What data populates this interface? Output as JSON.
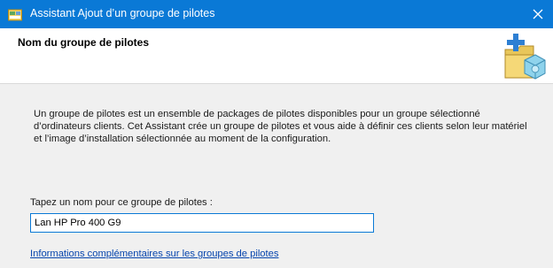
{
  "window": {
    "title": "Assistant Ajout d’un groupe de pilotes",
    "close_glyph": "✕"
  },
  "header": {
    "title": "Nom du groupe de pilotes",
    "icon": "driver-group-folder-icon"
  },
  "content": {
    "description": "Un groupe de pilotes est un ensemble de packages de pilotes disponibles pour un groupe sélectionné d’ordinateurs clients. Cet Assistant crée un groupe de pilotes et vous aide à définir ces clients selon leur matériel et l’image d’installation sélectionnée au moment de la configuration.",
    "name_label": "Tapez un nom pour ce groupe de pilotes :",
    "name_value": "Lan HP Pro 400 G9",
    "more_info_link": "Informations complémentaires sur les groupes de pilotes"
  },
  "colors": {
    "titlebar": "#0a79d6",
    "link": "#0645ad",
    "input_focus_border": "#0a79d6"
  }
}
